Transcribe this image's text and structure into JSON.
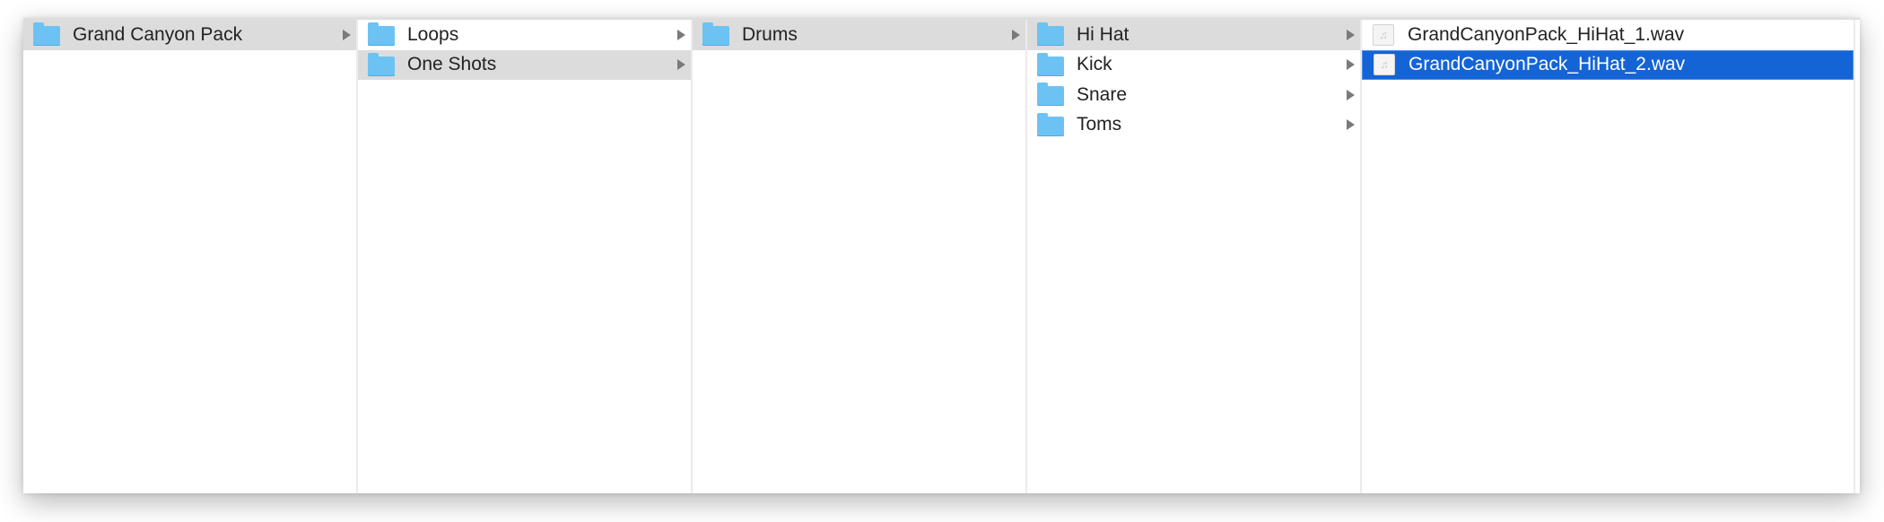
{
  "window": {
    "type": "finder-column-view"
  },
  "columns": [
    {
      "items": [
        {
          "label": "Grand Canyon Pack",
          "icon": "folder-icon",
          "state": "path",
          "has_children": true
        }
      ]
    },
    {
      "items": [
        {
          "label": "Loops",
          "icon": "folder-icon",
          "state": "normal",
          "has_children": true
        },
        {
          "label": "One Shots",
          "icon": "folder-icon",
          "state": "path",
          "has_children": true
        }
      ]
    },
    {
      "items": [
        {
          "label": "Drums",
          "icon": "folder-icon",
          "state": "path",
          "has_children": true
        }
      ]
    },
    {
      "items": [
        {
          "label": "Hi Hat",
          "icon": "folder-icon",
          "state": "path",
          "has_children": true
        },
        {
          "label": "Kick",
          "icon": "folder-icon",
          "state": "normal",
          "has_children": true
        },
        {
          "label": "Snare",
          "icon": "folder-icon",
          "state": "normal",
          "has_children": true
        },
        {
          "label": "Toms",
          "icon": "folder-icon",
          "state": "normal",
          "has_children": true
        }
      ]
    },
    {
      "items": [
        {
          "label": "GrandCanyonPack_HiHat_1.wav",
          "icon": "audio-file-icon",
          "state": "normal",
          "has_children": false
        },
        {
          "label": "GrandCanyonPack_HiHat_2.wav",
          "icon": "audio-file-icon",
          "state": "selected",
          "has_children": false
        }
      ]
    }
  ],
  "icons": {
    "audio_file_glyph": "♫",
    "disclosure_arrow": "▶"
  },
  "colors": {
    "selection": "#1464d6",
    "path_highlight": "#dcdcdc",
    "folder": "#6cc3f3",
    "arrow": "#7a7a7a"
  }
}
